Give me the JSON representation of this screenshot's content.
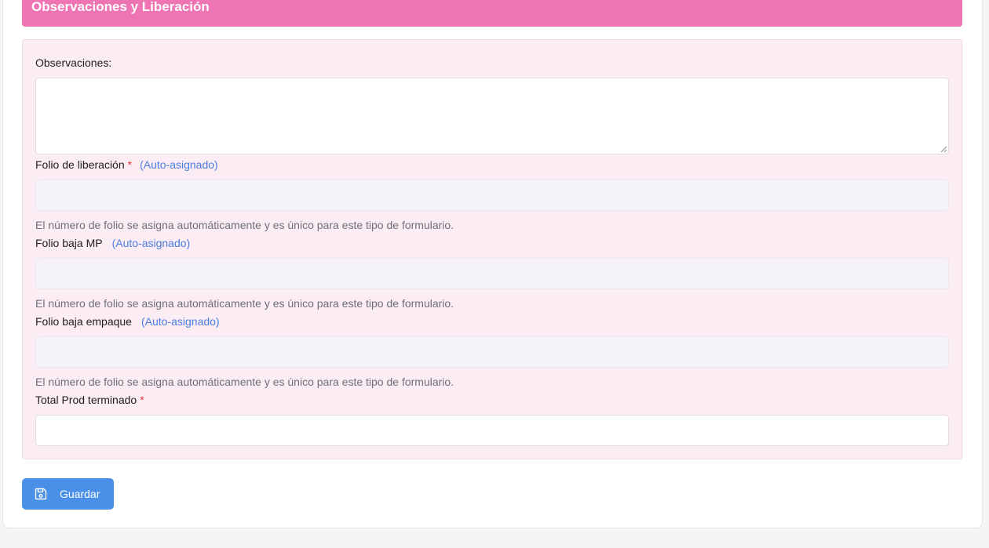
{
  "section": {
    "title": "Observaciones y Liberación"
  },
  "observaciones": {
    "label": "Observaciones:",
    "value": ""
  },
  "folio_liberacion": {
    "label": "Folio de liberación",
    "required_mark": "*",
    "auto_tag": "(Auto-asignado)",
    "value": "",
    "help": "El número de folio se asigna automáticamente y es único para este tipo de formulario."
  },
  "folio_baja_mp": {
    "label": "Folio baja MP",
    "auto_tag": "(Auto-asignado)",
    "value": "",
    "help": "El número de folio se asigna automáticamente y es único para este tipo de formulario."
  },
  "folio_baja_empaque": {
    "label": "Folio baja empaque",
    "auto_tag": "(Auto-asignado)",
    "value": "",
    "help": "El número de folio se asigna automáticamente y es único para este tipo de formulario."
  },
  "total_prod_terminado": {
    "label": "Total Prod terminado",
    "required_mark": "*",
    "value": ""
  },
  "actions": {
    "save_label": "Guardar"
  },
  "colors": {
    "header": "#ef74b4",
    "section_bg": "#fcedf4",
    "accent": "#4a90e8",
    "required": "#e23b3b",
    "auto_tag": "#4a7de0"
  },
  "icons": {
    "save": "floppy-disk-icon"
  }
}
